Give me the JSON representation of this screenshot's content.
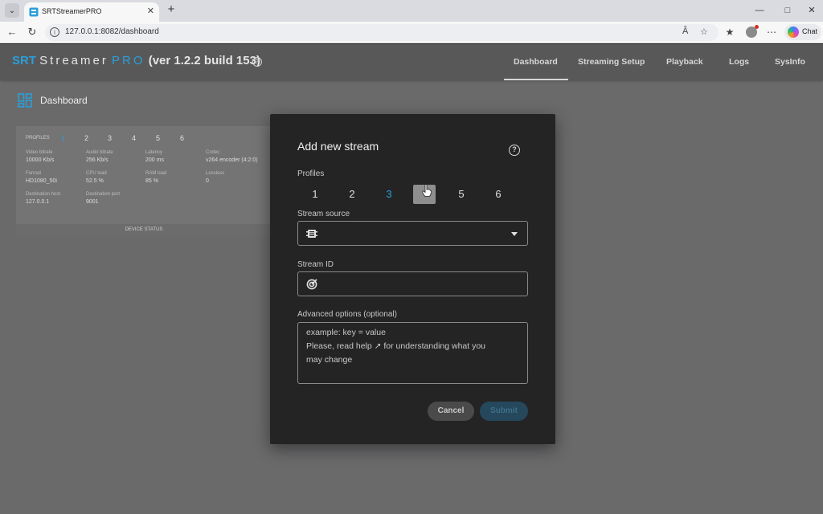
{
  "browser": {
    "tab_title": "SRTStreamerPRO",
    "url": "127.0.0.1:8082/dashboard",
    "chat_label": "Chat"
  },
  "app": {
    "brand": {
      "srt": "SRT",
      "streamer": "Streamer",
      "pro": "PRO",
      "version": "(ver 1.2.2 build 153)"
    },
    "nav": [
      "Dashboard",
      "Streaming Setup",
      "Playback",
      "Logs",
      "SysInfo"
    ],
    "active_nav": "Dashboard",
    "accent_color": "#2b9ed8",
    "page_title": "Dashboard"
  },
  "card": {
    "profiles_label": "PROFILES",
    "profiles": [
      "1",
      "2",
      "3",
      "4",
      "5",
      "6"
    ],
    "fields": [
      {
        "label": "Video bitrate",
        "value": "10000 Kb/s"
      },
      {
        "label": "Audio bitrate",
        "value": "256 Kb/s"
      },
      {
        "label": "Latency",
        "value": "200 ms"
      },
      {
        "label": "Codec",
        "value": "v264 encoder (4:2:0)"
      },
      {
        "label": "Format",
        "value": "HD1080_50i"
      },
      {
        "label": "CPU load",
        "value": "52.5 %"
      },
      {
        "label": "RAM load",
        "value": "85 %"
      },
      {
        "label": "Lossless",
        "value": "0"
      },
      {
        "label": "Destination host",
        "value": "127.0.0.1"
      },
      {
        "label": "Destination port",
        "value": "9001"
      }
    ],
    "footer": "DEVICE STATUS"
  },
  "modal": {
    "title": "Add new stream",
    "profiles_label": "Profiles",
    "profiles": [
      "1",
      "2",
      "3",
      "4",
      "5",
      "6"
    ],
    "active_profile": "3",
    "stream_source_label": "Stream source",
    "stream_source_value": "",
    "stream_id_label": "Stream ID",
    "stream_id_value": "",
    "advanced_label": "Advanced options (optional)",
    "advanced_placeholder_line1": "example: key = value",
    "advanced_placeholder_line2": "Please, read help ↗ for understanding what you",
    "advanced_placeholder_line3": "may change",
    "cancel_label": "Cancel",
    "submit_label": "Submit"
  }
}
